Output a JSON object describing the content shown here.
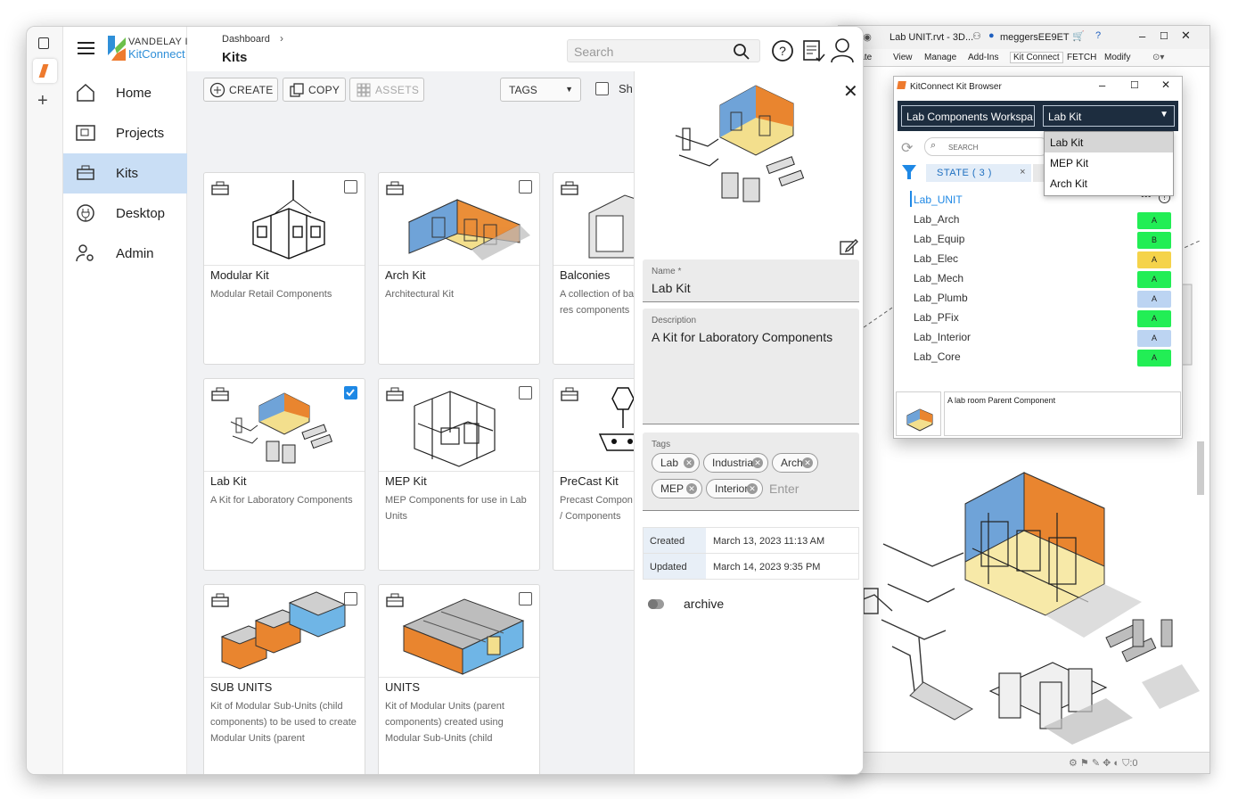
{
  "revit": {
    "title": "Lab UNIT.rvt - 3D...",
    "user": "meggersEE9ET",
    "ribbon_tabs": [
      "rate",
      "View",
      "Manage",
      "Add-Ins",
      "Kit Connect",
      "FETCH",
      "Modify"
    ]
  },
  "kit_browser": {
    "title": "KitConnect Kit Browser",
    "workspace": "Lab Components Workspa",
    "selected_kit": "Lab Kit",
    "dropdown_options": [
      "Lab Kit",
      "MEP Kit",
      "Arch Kit"
    ],
    "search_placeholder": "SEARCH",
    "filter_chip": "STATE  ( 3 )",
    "parent": "Lab_UNIT",
    "components": [
      {
        "name": "Lab_Arch",
        "state": "A",
        "color": "#22ee55"
      },
      {
        "name": "Lab_Equip",
        "state": "B",
        "color": "#22ee55"
      },
      {
        "name": "Lab_Elec",
        "state": "A",
        "color": "#f5d34a"
      },
      {
        "name": "Lab_Mech",
        "state": "A",
        "color": "#22ee55"
      },
      {
        "name": "Lab_Plumb",
        "state": "A",
        "color": "#bcd4f2"
      },
      {
        "name": "Lab_PFix",
        "state": "A",
        "color": "#22ee55"
      },
      {
        "name": "Lab_Interior",
        "state": "A",
        "color": "#bcd4f2"
      },
      {
        "name": "Lab_Core",
        "state": "A",
        "color": "#22ee55"
      }
    ],
    "preview_text": "A lab room Parent Component"
  },
  "app": {
    "brand_top": "VANDELAY IND...",
    "brand_bottom": "KitConnect",
    "breadcrumb": "Dashboard",
    "page_title": "Kits",
    "search_placeholder": "Search",
    "nav": [
      {
        "label": "Home"
      },
      {
        "label": "Projects"
      },
      {
        "label": "Kits"
      },
      {
        "label": "Desktop"
      },
      {
        "label": "Admin"
      }
    ],
    "toolbar": {
      "create": "CREATE",
      "copy": "COPY",
      "assets": "ASSETS",
      "tags": "TAGS",
      "show": "Sh"
    },
    "cards": [
      {
        "name": "Modular Kit",
        "desc": "Modular Retail Components",
        "checked": false
      },
      {
        "name": "Arch Kit",
        "desc": "Architectural Kit",
        "checked": false
      },
      {
        "name": "Balconies",
        "desc": "A collection of ba in multifamily res components",
        "checked": false
      },
      {
        "name": "Lab Kit",
        "desc": "A Kit for Laboratory Components",
        "checked": true
      },
      {
        "name": "MEP Kit",
        "desc": "MEP Components for use in Lab Units",
        "checked": false
      },
      {
        "name": "PreCast Kit",
        "desc": "Precast Compon Parking Garage / Components",
        "checked": false
      },
      {
        "name": "SUB UNITS",
        "desc": "Kit of Modular Sub-Units (child components) to be used to create Modular Units (parent",
        "checked": false
      },
      {
        "name": "UNITS",
        "desc": "Kit of Modular Units (parent components) created using Modular Sub-Units (child",
        "checked": false
      }
    ],
    "detail": {
      "name_label": "Name *",
      "name_value": "Lab Kit",
      "description_label": "Description",
      "description_value": "A Kit for Laboratory Components",
      "tags_label": "Tags",
      "tags": [
        "Lab",
        "Industrial",
        "Arch",
        "MEP",
        "Interior"
      ],
      "tags_placeholder": "Enter",
      "created_label": "Created",
      "created_value": "March 13, 2023 11:13 AM",
      "updated_label": "Updated",
      "updated_value": "March 14, 2023 9:35 PM",
      "archive_label": "archive",
      "archive_on": false
    }
  }
}
